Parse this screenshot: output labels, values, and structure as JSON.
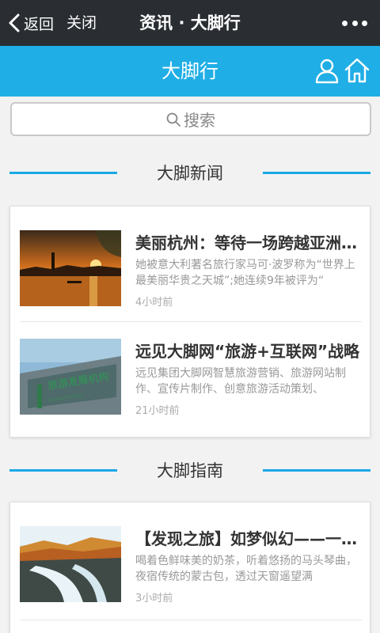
{
  "topbar": {
    "back_label": "返回",
    "close_label": "关闭",
    "title": "资讯 · 大脚行"
  },
  "header": {
    "title": "大脚行"
  },
  "search": {
    "placeholder": "搜索"
  },
  "sections": [
    {
      "title": "大脚新闻",
      "items": [
        {
          "title": "美丽杭州：等待一场跨越亚洲的相遇",
          "summary": "她被意大利著名旅行家马可·波罗称为“世界上最美丽华贵之天城”;她连续9年被评为“",
          "time": "4小时前",
          "image": "hangzhou-sunset-lake"
        },
        {
          "title": "远见大脚网“旅游+互联网”战略",
          "summary": "远见集团大脚网智慧旅游营销、旅游网站制作、宣传片制作、创意旅游活动策划、",
          "time": "21小时前",
          "image": "tourism-development-sign"
        }
      ]
    },
    {
      "title": "大脚指南",
      "items": [
        {
          "title": "【发现之旅】如梦似幻——一场旅行",
          "summary": "喝着色鲜味美的奶茶，听着悠扬的马头琴曲，夜宿传统的蒙古包，透过天窗遥望满",
          "time": "3小时前",
          "image": "autumn-river-landscape"
        }
      ]
    }
  ],
  "colors": {
    "topbar_bg": "#2a2e33",
    "header_bg": "#20aee6",
    "accent_line": "#1aa8e6",
    "page_bg": "#f2f2f2"
  },
  "icons": [
    "back-chevron-icon",
    "more-dots-icon",
    "user-icon",
    "home-icon",
    "search-icon"
  ]
}
